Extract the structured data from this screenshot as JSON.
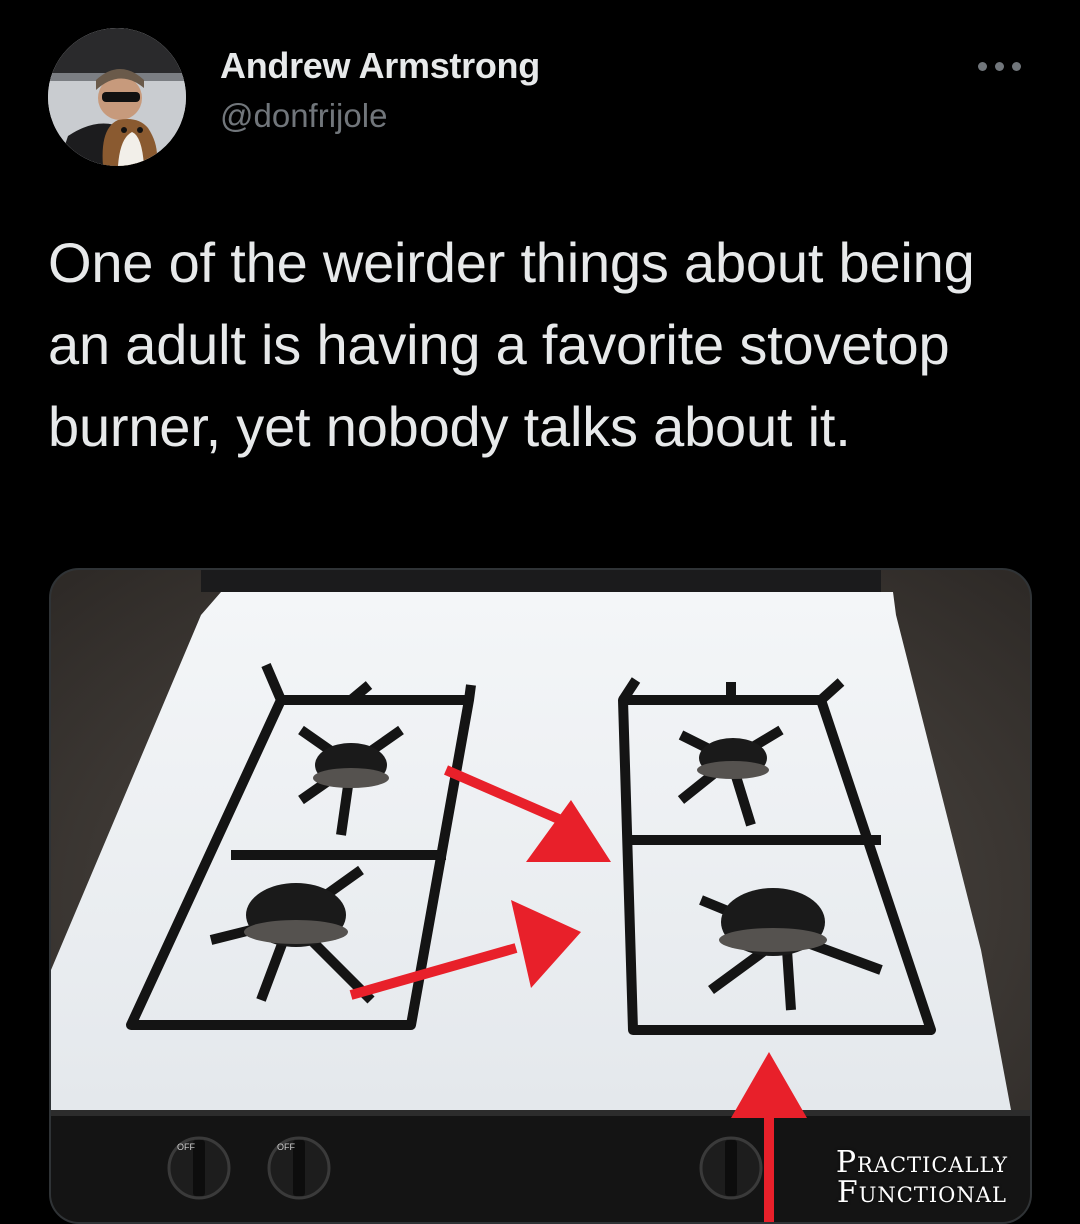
{
  "tweet": {
    "author": {
      "display_name": "Andrew Armstrong",
      "handle": "@donfrijole"
    },
    "more_icon": "more-horizontal-icon",
    "text": "One of the weirder things about being an adult is having a favorite stovetop burner, yet nobody talks about it.",
    "media": {
      "watermark_line1": "Practically",
      "watermark_line2": "Functional",
      "knob_labels": [
        "OFF",
        "OFF"
      ]
    }
  },
  "colors": {
    "background": "#000000",
    "text": "#e7e9ea",
    "secondary": "#71767b",
    "arrow": "#e8202a"
  }
}
